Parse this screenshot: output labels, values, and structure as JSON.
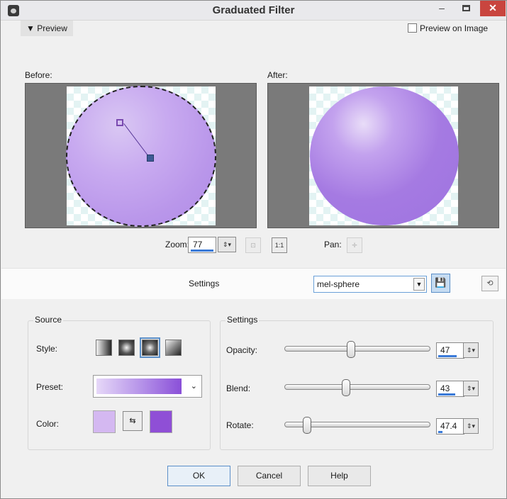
{
  "window": {
    "title": "Graduated Filter",
    "minimize": "–",
    "close": "✕",
    "colors": {
      "close_bg": "#c9453f",
      "accent": "#5b8fc8"
    }
  },
  "preview": {
    "toggle_label": "▼ Preview",
    "on_image_label": "Preview on Image",
    "on_image_checked": false,
    "before_label": "Before:",
    "after_label": "After:"
  },
  "zoom": {
    "label": "Zoom:",
    "value": "77",
    "pan_label": "Pan:"
  },
  "settings_bar": {
    "label": "Settings",
    "preset_value": "mel-sphere"
  },
  "source": {
    "group_title": "Source",
    "style_label": "Style:",
    "style_options": [
      "linear",
      "rectangular",
      "radial",
      "corner"
    ],
    "style_selected": "radial",
    "preset_label": "Preset:",
    "color_label": "Color:",
    "color_start": "#d4b8f1",
    "color_end": "#8f4fd6"
  },
  "settings": {
    "group_title": "Settings",
    "opacity_label": "Opacity:",
    "opacity_value": "47",
    "opacity_fraction": 0.47,
    "blend_label": "Blend:",
    "blend_value": "43",
    "blend_fraction": 0.43,
    "rotate_label": "Rotate:",
    "rotate_value": "47.4",
    "rotate_fraction": 0.13
  },
  "buttons": {
    "ok": "OK",
    "cancel": "Cancel",
    "help": "Help"
  }
}
